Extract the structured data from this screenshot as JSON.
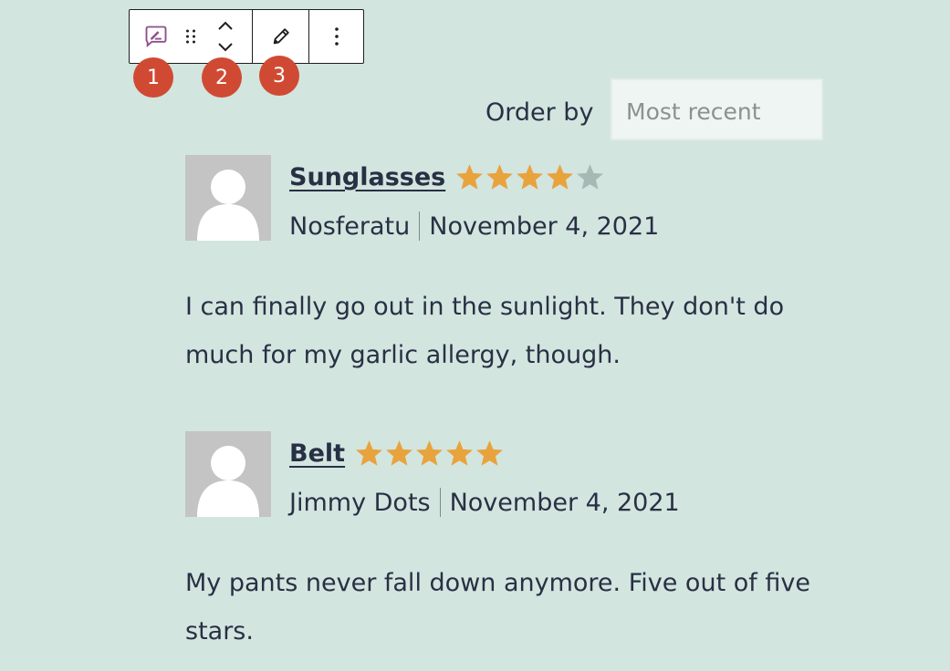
{
  "toolbar": {
    "buttons": [
      {
        "icon": "comment-edit-icon"
      },
      {
        "icon": "drag-handle-icon"
      },
      {
        "icon": "move-up-down-icon"
      },
      {
        "icon": "pencil-icon"
      },
      {
        "icon": "more-options-icon"
      }
    ],
    "accent_color": "#8e4f8a"
  },
  "callouts": [
    "1",
    "2",
    "3"
  ],
  "callout_color": "#d04a33",
  "order": {
    "label": "Order by",
    "selected": "Most recent"
  },
  "reviews": [
    {
      "product": "Sunglasses",
      "rating": 4,
      "max_rating": 5,
      "author": "Nosferatu",
      "date": "November 4, 2021",
      "text": "I can finally go out in the sunlight. They don't do much for my garlic allergy, though."
    },
    {
      "product": "Belt",
      "rating": 5,
      "max_rating": 5,
      "author": "Jimmy Dots",
      "date": "November 4, 2021",
      "text": "My pants never fall down anymore. Five out of five stars."
    }
  ],
  "colors": {
    "background": "#d3e5df",
    "star_filled": "#e8a33d",
    "star_empty": "#a7b9b5",
    "text": "#283044"
  }
}
